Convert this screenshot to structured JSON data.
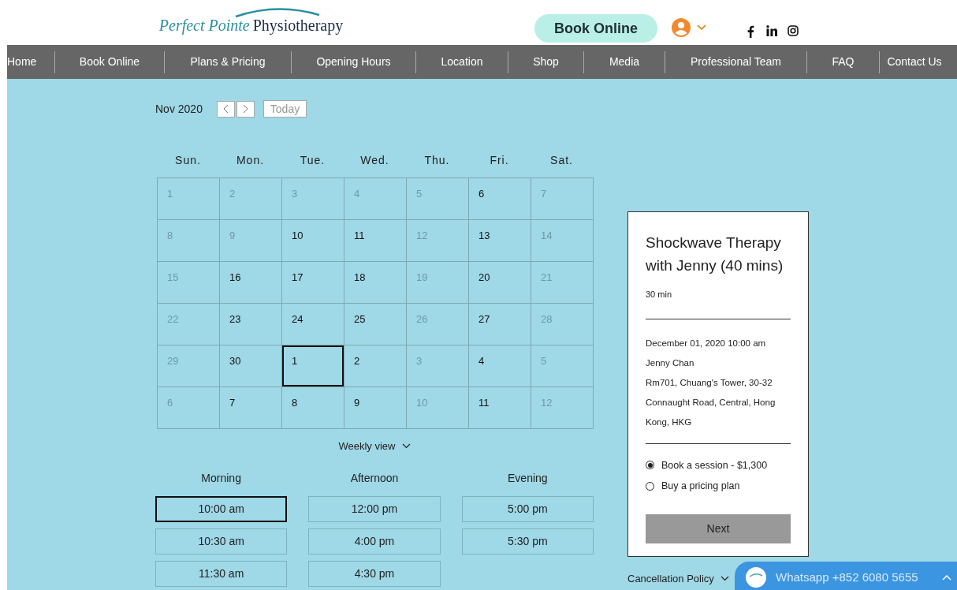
{
  "header": {
    "logo": {
      "part_1": "Perfect Pointe",
      "part_2": "Physiotherapy"
    },
    "book_button": "Book Online"
  },
  "nav": [
    "Home",
    "Book Online",
    "Plans & Pricing",
    "Opening Hours",
    "Location",
    "Shop",
    "Media",
    "Professional Team",
    "FAQ",
    "Contact Us"
  ],
  "calendar": {
    "month": "Nov 2020",
    "today_button": "Today",
    "weekdays": [
      "Sun.",
      "Mon.",
      "Tue.",
      "Wed.",
      "Thu.",
      "Fri.",
      "Sat."
    ],
    "days": [
      {
        "label": "1",
        "available": false,
        "selected": false
      },
      {
        "label": "2",
        "available": false,
        "selected": false
      },
      {
        "label": "3",
        "available": false,
        "selected": false
      },
      {
        "label": "4",
        "available": false,
        "selected": false
      },
      {
        "label": "5",
        "available": false,
        "selected": false
      },
      {
        "label": "6",
        "available": true,
        "selected": false
      },
      {
        "label": "7",
        "available": false,
        "selected": false
      },
      {
        "label": "8",
        "available": false,
        "selected": false
      },
      {
        "label": "9",
        "available": false,
        "selected": false
      },
      {
        "label": "10",
        "available": true,
        "selected": false
      },
      {
        "label": "11",
        "available": true,
        "selected": false
      },
      {
        "label": "12",
        "available": false,
        "selected": false
      },
      {
        "label": "13",
        "available": true,
        "selected": false
      },
      {
        "label": "14",
        "available": false,
        "selected": false
      },
      {
        "label": "15",
        "available": false,
        "selected": false
      },
      {
        "label": "16",
        "available": true,
        "selected": false
      },
      {
        "label": "17",
        "available": true,
        "selected": false
      },
      {
        "label": "18",
        "available": true,
        "selected": false
      },
      {
        "label": "19",
        "available": false,
        "selected": false
      },
      {
        "label": "20",
        "available": true,
        "selected": false
      },
      {
        "label": "21",
        "available": false,
        "selected": false
      },
      {
        "label": "22",
        "available": false,
        "selected": false
      },
      {
        "label": "23",
        "available": true,
        "selected": false
      },
      {
        "label": "24",
        "available": true,
        "selected": false
      },
      {
        "label": "25",
        "available": true,
        "selected": false
      },
      {
        "label": "26",
        "available": false,
        "selected": false
      },
      {
        "label": "27",
        "available": true,
        "selected": false
      },
      {
        "label": "28",
        "available": false,
        "selected": false
      },
      {
        "label": "29",
        "available": false,
        "selected": false
      },
      {
        "label": "30",
        "available": true,
        "selected": false
      },
      {
        "label": "1",
        "available": true,
        "selected": true
      },
      {
        "label": "2",
        "available": true,
        "selected": false
      },
      {
        "label": "3",
        "available": false,
        "selected": false
      },
      {
        "label": "4",
        "available": true,
        "selected": false
      },
      {
        "label": "5",
        "available": false,
        "selected": false
      },
      {
        "label": "6",
        "available": false,
        "selected": false
      },
      {
        "label": "7",
        "available": true,
        "selected": false
      },
      {
        "label": "8",
        "available": true,
        "selected": false
      },
      {
        "label": "9",
        "available": true,
        "selected": false
      },
      {
        "label": "10",
        "available": false,
        "selected": false
      },
      {
        "label": "11",
        "available": true,
        "selected": false
      },
      {
        "label": "12",
        "available": false,
        "selected": false
      }
    ],
    "view_toggle": "Weekly view"
  },
  "time_slots": [
    {
      "heading": "Morning",
      "slots": [
        {
          "label": "10:00 am",
          "selected": true
        },
        {
          "label": "10:30 am",
          "selected": false
        },
        {
          "label": "11:30 am",
          "selected": false
        }
      ]
    },
    {
      "heading": "Afternoon",
      "slots": [
        {
          "label": "12:00 pm",
          "selected": false
        },
        {
          "label": "4:00 pm",
          "selected": false
        },
        {
          "label": "4:30 pm",
          "selected": false
        }
      ]
    },
    {
      "heading": "Evening",
      "slots": [
        {
          "label": "5:00 pm",
          "selected": false
        },
        {
          "label": "5:30 pm",
          "selected": false
        }
      ]
    }
  ],
  "booking_card": {
    "title": "Shockwave Therapy with Jenny (40 mins)",
    "duration": "30 min",
    "details": [
      "December 01, 2020 10:00 am",
      "Jenny Chan",
      "Rm701, Chuang's Tower, 30-32 Connaught Road, Central, Hong Kong, HKG"
    ],
    "options": [
      {
        "label": "Book a session - $1,300",
        "selected": true
      },
      {
        "label": "Buy a pricing plan",
        "selected": false
      }
    ],
    "next_button": "Next"
  },
  "cancellation_policy": "Cancellation Policy",
  "whatsapp": "Whatsapp +852 6080 5655"
}
